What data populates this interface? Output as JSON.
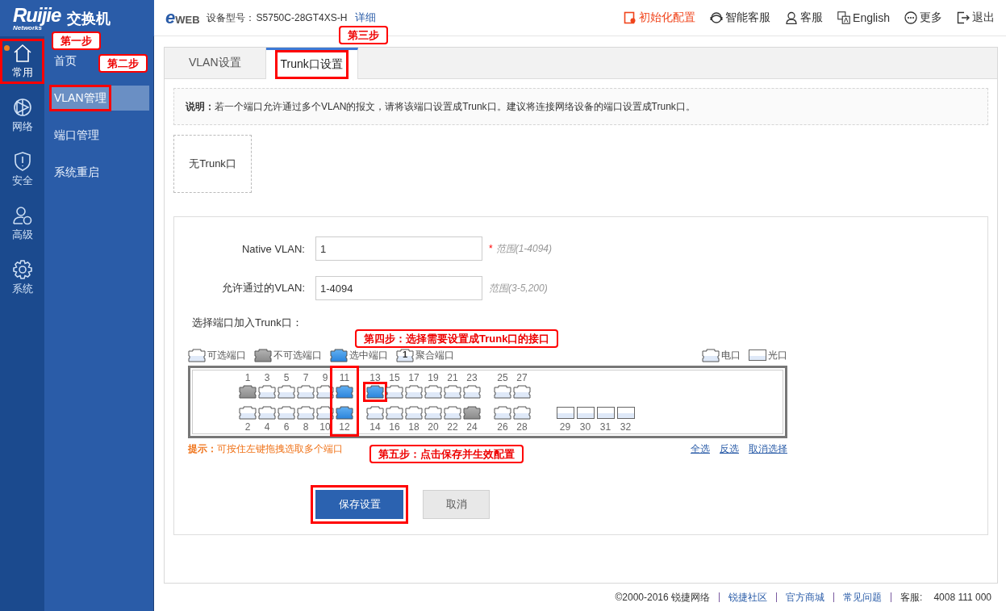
{
  "header": {
    "logo": {
      "brand": "Ruijie",
      "sub": "Networks"
    },
    "product": "交换机",
    "eweb": {
      "e": "e",
      "web": "WEB"
    },
    "device_label": "设备型号：",
    "device_model": "S5750C-28GT4XS-H",
    "detail_link": "详细",
    "actions": [
      {
        "label": "初始化配置",
        "kind": "reset",
        "emphasis": true
      },
      {
        "label": "智能客服",
        "kind": "bot",
        "emphasis": false
      },
      {
        "label": "客服",
        "kind": "agent",
        "emphasis": false
      },
      {
        "label": "English",
        "kind": "language",
        "emphasis": false
      },
      {
        "label": "更多",
        "kind": "more",
        "emphasis": false
      },
      {
        "label": "退出",
        "kind": "logout",
        "emphasis": false
      }
    ]
  },
  "nav": [
    {
      "label": "常用",
      "kind": "home",
      "selected": true,
      "highlighted": true
    },
    {
      "label": "网络",
      "kind": "network",
      "selected": false,
      "highlighted": false
    },
    {
      "label": "安全",
      "kind": "security",
      "selected": false,
      "highlighted": false
    },
    {
      "label": "高级",
      "kind": "advanced",
      "selected": false,
      "highlighted": false
    },
    {
      "label": "系统",
      "kind": "system",
      "selected": false,
      "highlighted": false
    }
  ],
  "submenu": [
    {
      "label": "首页",
      "selected": false,
      "highlighted": false
    },
    {
      "label": "VLAN管理",
      "selected": true,
      "highlighted": true
    },
    {
      "label": "端口管理",
      "selected": false,
      "highlighted": false
    },
    {
      "label": "系统重启",
      "selected": false,
      "highlighted": false
    }
  ],
  "tabs": [
    {
      "label": "VLAN设置",
      "selected": false,
      "highlighted": false
    },
    {
      "label": "Trunk口设置",
      "selected": true,
      "highlighted": true
    }
  ],
  "notice": "**说明：** 若一个端口允许通过多个VLAN的报文，请将该端口设置成Trunk口。建议将连接网络设备的端口设置成Trunk口。",
  "trunk_list": {
    "empty_text": "无Trunk口"
  },
  "form": {
    "fields": [
      {
        "label": "Native VLAN:",
        "value": "1",
        "mark": "*",
        "hint": "范围(1-4094)"
      },
      {
        "label": "允许通过的VLAN:",
        "value": "1-4094",
        "hint": "范围(3-5,200)"
      }
    ],
    "port_prompt": "选择端口加入Trunk口：",
    "legend": [
      {
        "label": "可选端口",
        "kind": "available"
      },
      {
        "label": "不可选端口",
        "kind": "unavailable"
      },
      {
        "label": "选中端口",
        "kind": "selected"
      },
      {
        "label": "聚合端口",
        "kind": "aggregate",
        "badge": "1"
      }
    ],
    "media_legend": [
      {
        "label": "电口",
        "kind": "copper"
      },
      {
        "label": "光口",
        "kind": "fiber"
      }
    ],
    "port_groups": [
      {
        "kind": "copper",
        "columns": [
          {
            "highlighted": false,
            "top": {
              "label": "1",
              "kind": "unavailable",
              "highlighted": false
            },
            "bottom": {
              "label": "2",
              "kind": "available",
              "highlighted": false
            }
          },
          {
            "highlighted": false,
            "top": {
              "label": "3",
              "kind": "available",
              "highlighted": false
            },
            "bottom": {
              "label": "4",
              "kind": "available",
              "highlighted": false
            }
          },
          {
            "highlighted": false,
            "top": {
              "label": "5",
              "kind": "available",
              "highlighted": false
            },
            "bottom": {
              "label": "6",
              "kind": "available",
              "highlighted": false
            }
          },
          {
            "highlighted": false,
            "top": {
              "label": "7",
              "kind": "available",
              "highlighted": false
            },
            "bottom": {
              "label": "8",
              "kind": "available",
              "highlighted": false
            }
          },
          {
            "highlighted": false,
            "top": {
              "label": "9",
              "kind": "available",
              "highlighted": false
            },
            "bottom": {
              "label": "10",
              "kind": "available",
              "highlighted": false
            }
          },
          {
            "highlighted": true,
            "top": {
              "label": "11",
              "kind": "selected"
            },
            "bottom": {
              "label": "12",
              "kind": "selected"
            }
          }
        ]
      },
      {
        "kind": "copper",
        "columns": [
          {
            "highlighted": false,
            "top": {
              "label": "13",
              "kind": "selected",
              "highlighted": true
            },
            "bottom": {
              "label": "14",
              "kind": "available",
              "highlighted": false
            }
          },
          {
            "highlighted": false,
            "top": {
              "label": "15",
              "kind": "available",
              "highlighted": false
            },
            "bottom": {
              "label": "16",
              "kind": "available",
              "highlighted": false
            }
          },
          {
            "highlighted": false,
            "top": {
              "label": "17",
              "kind": "available",
              "highlighted": false
            },
            "bottom": {
              "label": "18",
              "kind": "available",
              "highlighted": false
            }
          },
          {
            "highlighted": false,
            "top": {
              "label": "19",
              "kind": "available",
              "highlighted": false
            },
            "bottom": {
              "label": "20",
              "kind": "available",
              "highlighted": false
            }
          },
          {
            "highlighted": false,
            "top": {
              "label": "21",
              "kind": "available",
              "highlighted": false
            },
            "bottom": {
              "label": "22",
              "kind": "available",
              "highlighted": false
            }
          },
          {
            "highlighted": false,
            "top": {
              "label": "23",
              "kind": "available",
              "highlighted": false
            },
            "bottom": {
              "label": "24",
              "kind": "unavailable",
              "highlighted": false
            }
          }
        ]
      },
      {
        "kind": "copper",
        "columns": [
          {
            "highlighted": false,
            "top": {
              "label": "25",
              "kind": "available",
              "highlighted": false
            },
            "bottom": {
              "label": "26",
              "kind": "available",
              "highlighted": false
            }
          },
          {
            "highlighted": false,
            "top": {
              "label": "27",
              "kind": "available",
              "highlighted": false
            },
            "bottom": {
              "label": "28",
              "kind": "available",
              "highlighted": false
            }
          }
        ]
      },
      {
        "kind": "fiber",
        "columns": [
          {
            "highlighted": false,
            "bottom": {
              "label": "29",
              "kind": "available",
              "highlighted": false
            }
          },
          {
            "highlighted": false,
            "bottom": {
              "label": "30",
              "kind": "available",
              "highlighted": false
            }
          },
          {
            "highlighted": false,
            "bottom": {
              "label": "31",
              "kind": "available",
              "highlighted": false
            }
          },
          {
            "highlighted": false,
            "bottom": {
              "label": "32",
              "kind": "available",
              "highlighted": false
            }
          }
        ]
      }
    ],
    "hint": "**提示：**可按住左键拖拽选取多个端口",
    "links": [
      "全选",
      "反选",
      "取消选择"
    ],
    "buttons": [
      {
        "label": "保存设置",
        "kind": "primary",
        "highlighted": true
      },
      {
        "label": "取消",
        "kind": "secondary",
        "highlighted": false
      }
    ]
  },
  "callouts": [
    {
      "text": "第一步"
    },
    {
      "text": "第二步"
    },
    {
      "text": "第三步"
    },
    {
      "text": "第四步：选择需要设置成Trunk口的接口"
    },
    {
      "text": "第五步：点击保存并生效配置"
    }
  ],
  "footer": {
    "copyright": "©2000-2016 锐捷网络",
    "links": [
      "锐捷社区",
      "官方商城",
      "常见问题"
    ],
    "hotline_label": "客服:",
    "hotline": "4008 111 000"
  }
}
